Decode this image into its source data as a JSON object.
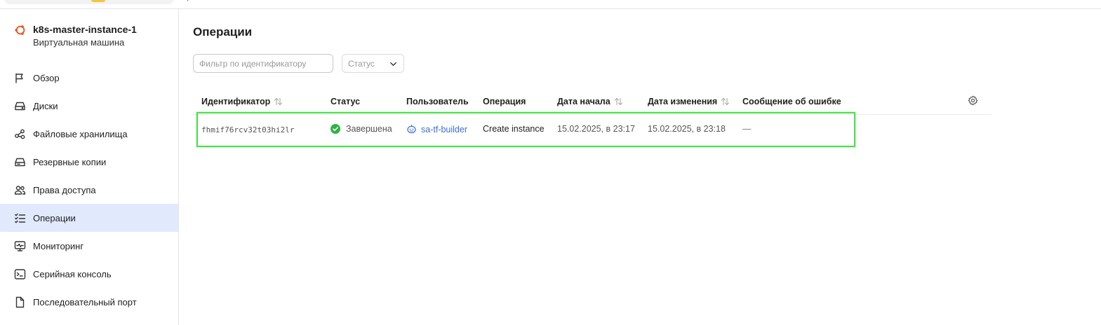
{
  "colors": {
    "accent": "#3b6fd4",
    "active_nav_bg": "#e1e9fc",
    "success": "#2fb344",
    "ubuntu_orange": "#e95420",
    "highlight": "#4be04b"
  },
  "vm": {
    "name": "k8s-master-instance-1",
    "type": "Виртуальная машина",
    "icon": "ubuntu-icon"
  },
  "sidebar": {
    "items": [
      {
        "label": "Обзор",
        "icon": "flag-icon"
      },
      {
        "label": "Диски",
        "icon": "disk-icon"
      },
      {
        "label": "Файловые хранилища",
        "icon": "share-nodes-icon"
      },
      {
        "label": "Резервные копии",
        "icon": "backup-icon"
      },
      {
        "label": "Права доступа",
        "icon": "users-icon"
      },
      {
        "label": "Операции",
        "icon": "checklist-icon",
        "active": true
      },
      {
        "label": "Мониторинг",
        "icon": "monitor-icon"
      },
      {
        "label": "Серийная консоль",
        "icon": "terminal-icon"
      },
      {
        "label": "Последовательный порт",
        "icon": "file-icon"
      }
    ]
  },
  "main": {
    "title": "Операции",
    "filter": {
      "placeholder": "Фильтр по идентификатору",
      "value": ""
    },
    "status_select": {
      "label": "Статус"
    },
    "table": {
      "columns": [
        {
          "label": "Идентификатор",
          "sortable": true
        },
        {
          "label": "Статус",
          "sortable": false
        },
        {
          "label": "Пользователь",
          "sortable": false
        },
        {
          "label": "Операция",
          "sortable": false
        },
        {
          "label": "Дата начала",
          "sortable": true
        },
        {
          "label": "Дата изменения",
          "sortable": true
        },
        {
          "label": "Сообщение об ошибке",
          "sortable": false
        }
      ],
      "rows": [
        {
          "id": "fhmif76rcv32t03hi2lr",
          "status": "Завершена",
          "user": "sa-tf-builder",
          "operation": "Create instance",
          "started": "15.02.2025, в 23:17",
          "modified": "15.02.2025, в 23:18",
          "error": "—"
        }
      ]
    }
  }
}
